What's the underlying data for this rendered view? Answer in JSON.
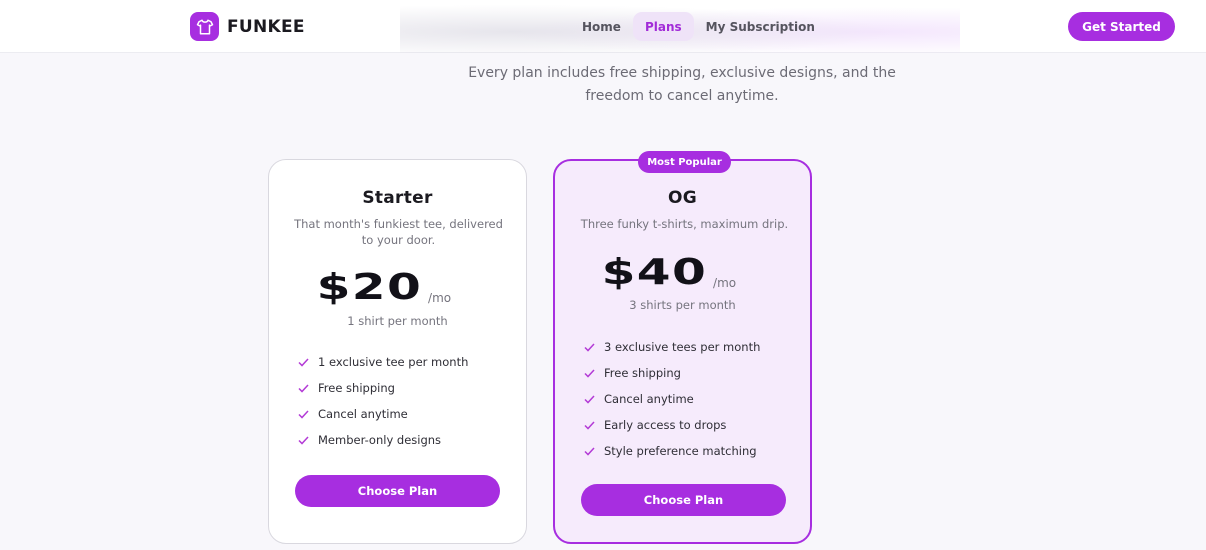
{
  "brand": {
    "name": "FUNKEE",
    "logo_icon": "tshirt-icon"
  },
  "nav": {
    "items": [
      {
        "label": "Home",
        "active": false
      },
      {
        "label": "Plans",
        "active": true
      },
      {
        "label": "My Subscription",
        "active": false
      }
    ]
  },
  "header": {
    "cta_label": "Get Started"
  },
  "intro": {
    "text": "Every plan includes free shipping, exclusive designs, and the freedom to cancel anytime."
  },
  "plans": [
    {
      "name": "Starter",
      "description": "That month's funkiest tee, delivered to your door.",
      "price": "$20",
      "period": "/mo",
      "note": "1 shirt per month",
      "features": [
        "1 exclusive tee per month",
        "Free shipping",
        "Cancel anytime",
        "Member-only designs"
      ],
      "button_label": "Choose Plan"
    },
    {
      "name": "OG",
      "badge": "Most Popular",
      "description": "Three funky t-shirts, maximum drip.",
      "price": "$40",
      "period": "/mo",
      "note": "3 shirts per month",
      "features": [
        "3 exclusive tees per month",
        "Free shipping",
        "Cancel anytime",
        "Early access to drops",
        "Style preference matching"
      ],
      "button_label": "Choose Plan"
    }
  ],
  "colors": {
    "accent": "#a72ee0",
    "accent_light": "#f6ebfc",
    "nav_active_bg": "#efe3f8",
    "check": "#b33ad6"
  }
}
